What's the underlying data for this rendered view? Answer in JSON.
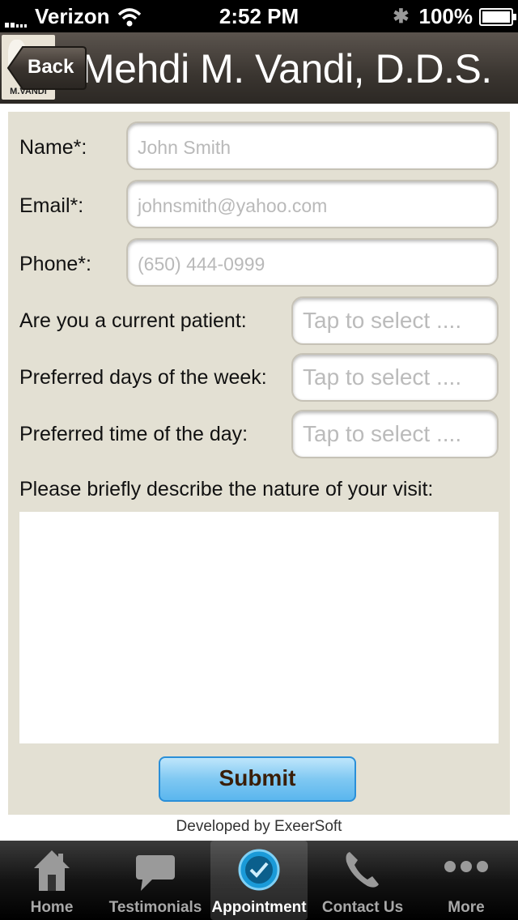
{
  "status_bar": {
    "carrier": "Verizon",
    "time": "2:52 PM",
    "battery": "100%"
  },
  "header": {
    "title": "Mehdi M. Vandi, D.D.S.",
    "back_label": "Back",
    "logo_text": "M.VANDI"
  },
  "form": {
    "name_label": "Name*:",
    "name_placeholder": "John Smith",
    "email_label": "Email*:",
    "email_placeholder": "johnsmith@yahoo.com",
    "phone_label": "Phone*:",
    "phone_placeholder": "(650) 444-0999",
    "patient_label": "Are you a current patient:",
    "patient_value": "Tap to select ....",
    "days_label": "Preferred days of the week:",
    "days_value": "Tap to select ....",
    "time_label": "Preferred time of the day:",
    "time_value": "Tap to select ....",
    "visit_label": "Please briefly describe the nature of your visit:",
    "visit_value": "",
    "submit_label": "Submit"
  },
  "credit": "Developed by ExeerSoft",
  "tabs": [
    {
      "label": "Home",
      "icon": "home-icon"
    },
    {
      "label": "Testimonials",
      "icon": "speech-bubble-icon"
    },
    {
      "label": "Appointment",
      "icon": "clock-check-icon",
      "active": true
    },
    {
      "label": "Contact Us",
      "icon": "phone-icon"
    },
    {
      "label": "More",
      "icon": "more-dots-icon"
    }
  ],
  "colors": {
    "panel_bg": "#e3e0d3",
    "submit_blue": "#5bb6ee",
    "tabbar_bg": "#141414"
  }
}
